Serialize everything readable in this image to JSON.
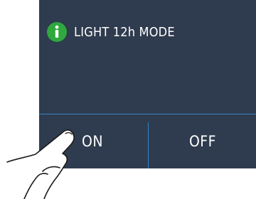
{
  "dialog": {
    "title": "LIGHT 12h MODE",
    "icon": "info-icon",
    "buttons": {
      "on_label": "ON",
      "off_label": "OFF"
    }
  },
  "colors": {
    "panel_background": "#2f3b4e",
    "info_icon": "#2fa83e",
    "divider": "#2f86c8",
    "text": "#ffffff"
  }
}
